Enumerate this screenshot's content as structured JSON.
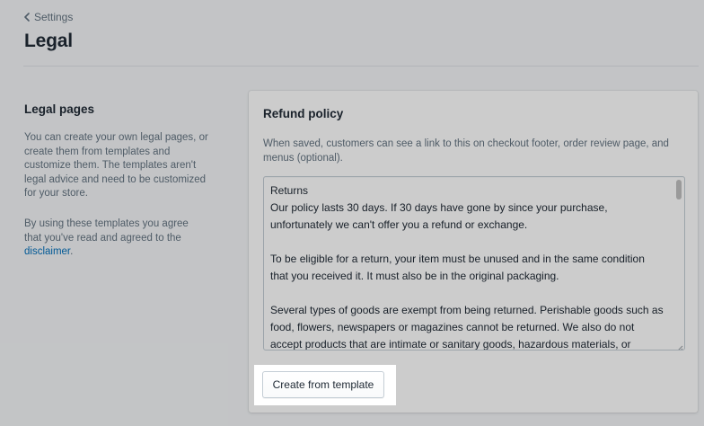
{
  "breadcrumb": {
    "label": "Settings"
  },
  "page": {
    "title": "Legal"
  },
  "sidebar": {
    "title": "Legal pages",
    "description": "You can create your own legal pages, or create them from templates and customize them. The templates aren't legal advice and need to be customized for your store.",
    "agreement_text": "By using these templates you agree that you've read and agreed to the",
    "disclaimer_link": "disclaimer",
    "agreement_end": "."
  },
  "refund_policy": {
    "title": "Refund policy",
    "help_text": "When saved, customers can see a link to this on checkout footer, order review page, and menus (optional).",
    "content": {
      "heading": "Returns",
      "paragraph1": "Our policy lasts 30 days. If 30 days have gone by since your purchase, unfortunately we can't offer you a refund or exchange.",
      "paragraph2": "To be eligible for a return, your item must be unused and in the same condition that you received it. It must also be in the original packaging.",
      "paragraph3": "Several types of goods are exempt from being returned. Perishable goods such as food, flowers, newspapers or magazines cannot be returned. We also do not accept products that are intimate or sanitary goods, hazardous materials, or flammable liquids or gases."
    },
    "template_button_label": "Create from template"
  },
  "icons": {
    "back": "chevron-left-icon",
    "resize": "resize-handle-icon"
  },
  "colors": {
    "page_background": "#f4f6f8",
    "card_background": "#ffffff",
    "link": "#006fbb",
    "overlay": "rgba(0,0,0,0.2)"
  }
}
